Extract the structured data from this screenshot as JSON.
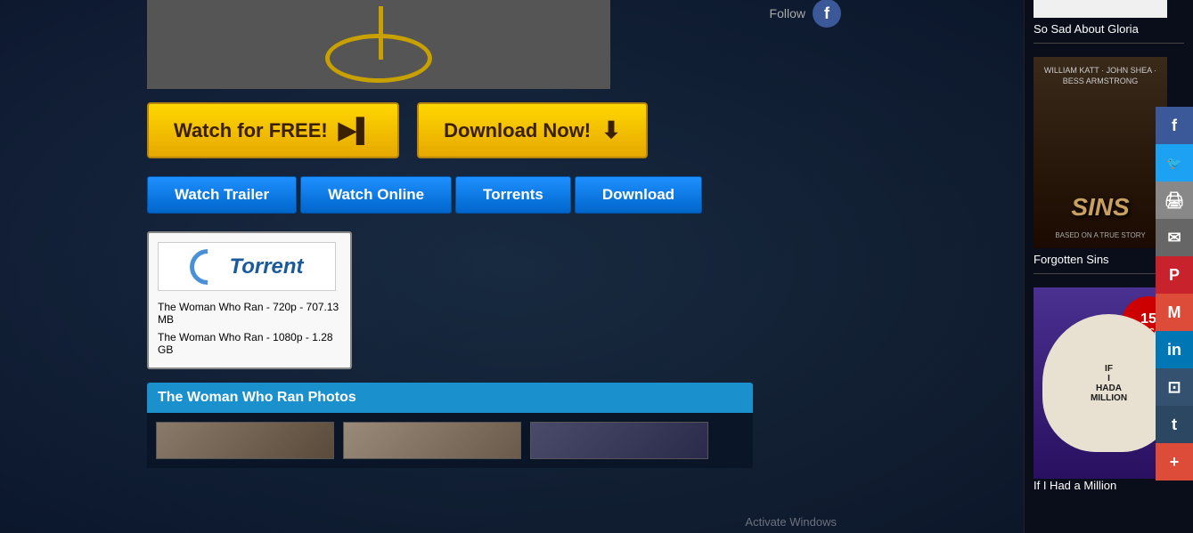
{
  "header": {
    "follow_label": "Follow"
  },
  "cta": {
    "watch_free_label": "Watch for FREE!",
    "watch_free_icon": "▶",
    "download_now_label": "Download Now!",
    "download_now_icon": "⬇"
  },
  "tabs": {
    "watch_trailer": "Watch Trailer",
    "watch_online": "Watch Online",
    "torrents": "Torrents",
    "download": "Download"
  },
  "torrent": {
    "logo_text": "Torrent",
    "link1": "The Woman Who Ran - 720p - 707.13 MB",
    "link2": "The Woman Who Ran - 1080p - 1.28 GB"
  },
  "photos_section": {
    "title": "The Woman Who Ran Photos"
  },
  "sidebar": {
    "so_sad_title": "So Sad About Gloria",
    "forgotten_sins_title": "Forgotten Sins",
    "if_had_million_title": "If I Had a Million",
    "forgotten_sins_text": "SINS",
    "million_star_cast": "STAR CAST",
    "million_number": "15",
    "million_text": "IF\nI\nHADA\nMILLION"
  },
  "social": {
    "facebook": "f",
    "twitter": "t",
    "print": "🖨",
    "email": "✉",
    "pinterest": "P",
    "gmail": "M",
    "linkedin": "in",
    "bookmark": "⊡",
    "tumblr": "t",
    "plus": "+"
  },
  "watermark": {
    "text": "Activate Windows"
  }
}
